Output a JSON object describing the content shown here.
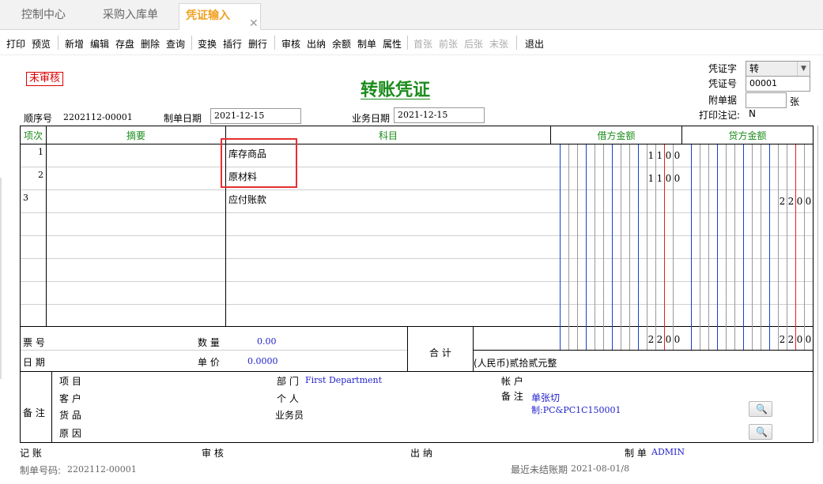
{
  "tabs": [
    "控制中心",
    "采购入库单",
    "凭证输入"
  ],
  "tab_close": "✕",
  "toolbar": {
    "print": "打印",
    "preview": "预览",
    "add": "新增",
    "edit": "编辑",
    "save": "存盘",
    "delete": "删除",
    "query": "查询",
    "swap": "变换",
    "insert_row": "插行",
    "delete_row": "删行",
    "review": "审核",
    "cashier": "出纳",
    "balance": "余额",
    "make": "制单",
    "props": "属性",
    "first": "首张",
    "prev": "前张",
    "next": "后张",
    "last": "末张",
    "exit": "退出"
  },
  "voucher": {
    "status": "未审核",
    "title": "转账凭证",
    "voucher_word_label": "凭证字",
    "voucher_word_value": "转",
    "voucher_no_label": "凭证号",
    "voucher_no_value": "00001",
    "attach_label": "附单据",
    "attach_unit": "张",
    "print_note_label": "打印注记:",
    "print_note_value": "N",
    "seq_label": "顺序号",
    "seq_value": "2202112-00001",
    "make_date_label": "制单日期",
    "make_date_value": "2021-12-15",
    "biz_date_label": "业务日期",
    "biz_date_value": "2021-12-15"
  },
  "table": {
    "headers": {
      "no": "项次",
      "summary": "摘要",
      "subject": "科目",
      "debit": "借方金额",
      "credit": "贷方金额"
    },
    "rows": [
      {
        "no": "1",
        "summary": "",
        "subject": "库存商品",
        "debit": "1100",
        "credit": ""
      },
      {
        "no": "2",
        "summary": "",
        "subject": "原材料",
        "debit": "1100",
        "credit": ""
      },
      {
        "no": "3",
        "summary": "",
        "subject": "应付账款",
        "debit": "",
        "credit": "2200"
      }
    ],
    "total_debit": "2200",
    "total_credit": "2200"
  },
  "footer": {
    "ticket_label": "票 号",
    "date_label": "日 期",
    "qty_label": "数 量",
    "qty_value": "0.00",
    "price_label": "单 价",
    "price_value": "0.0000",
    "total_label": "合 计",
    "amount_words": "(人民币)贰拾贰元整",
    "remark_label": "备 注",
    "project_label": "项 目",
    "customer_label": "客 户",
    "goods_label": "货 品",
    "reason_label": "原 因",
    "dept_label": "部 门",
    "dept_value": "First Department",
    "person_label": "个 人",
    "salesman_label": "业务员",
    "account_label": "帐 户",
    "note_label": "备 注",
    "note_line1": "单张切",
    "note_line2": "制:PC&PC1C150001"
  },
  "signatures": {
    "bookkeep_label": "记 账",
    "audit_label": "审 核",
    "cashier_label": "出 纳",
    "maker_label": "制 单",
    "maker_value": "ADMIN"
  },
  "bottom": {
    "doc_no_label": "制单号码:",
    "doc_no_value": "2202112-00001",
    "last_period_label": "最近未结账期",
    "last_period_value": "2021-08-01/8"
  }
}
